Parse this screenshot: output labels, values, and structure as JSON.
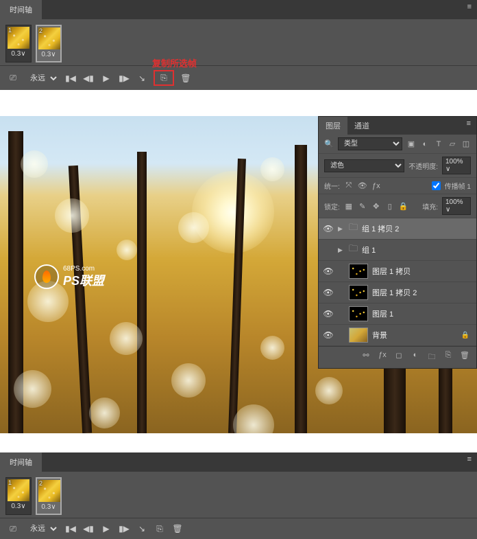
{
  "timeline": {
    "tab_label": "时间轴",
    "frames": [
      {
        "num": "1",
        "delay": "0.3",
        "selected": false
      },
      {
        "num": "2",
        "delay": "0.3",
        "selected": true
      }
    ],
    "loop": "永远",
    "annotation": "复制所选帧"
  },
  "watermark": {
    "url": "68PS.com",
    "brand": "PS联盟"
  },
  "layers_panel": {
    "tabs": {
      "layers": "图层",
      "channels": "通道"
    },
    "filter_kind": "类型",
    "blend_mode": "滤色",
    "opacity_label": "不透明度:",
    "opacity_value": "100%",
    "unify_label": "统一:",
    "propagate_label": "传播帧 1",
    "lock_label": "锁定:",
    "fill_label": "填充:",
    "fill_value": "100%",
    "layers": [
      {
        "type": "group",
        "name": "组 1 拷贝 2",
        "selected": true
      },
      {
        "type": "group",
        "name": "组 1"
      },
      {
        "type": "layer",
        "name": "图层 1 拷贝",
        "thumb": "dots"
      },
      {
        "type": "layer",
        "name": "图层 1 拷贝 2",
        "thumb": "dots"
      },
      {
        "type": "layer",
        "name": "图层 1",
        "thumb": "dots"
      },
      {
        "type": "layer",
        "name": "背景",
        "thumb": "bg",
        "locked": true
      }
    ]
  }
}
